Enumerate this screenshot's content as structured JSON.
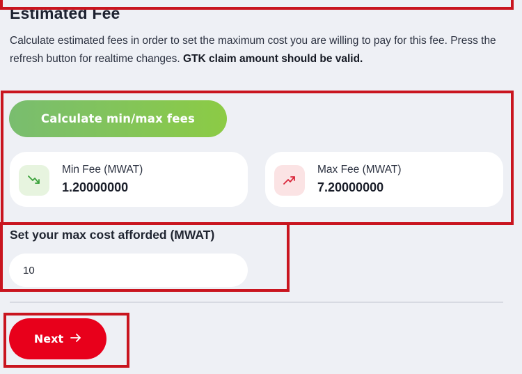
{
  "section": {
    "title": "Estimated Fee",
    "description_main": "Calculate estimated fees in order to set the maximum cost you are willing to pay for this fee. Press the refresh button for realtime changes.",
    "description_bold": "GTK claim amount should be valid."
  },
  "calculate_button": {
    "label": "Calculate min/max fees"
  },
  "fees": {
    "min": {
      "label": "Min Fee (MWAT)",
      "value": "1.20000000",
      "icon": "trending-down-icon",
      "color": "#3aa13a"
    },
    "max": {
      "label": "Max Fee (MWAT)",
      "value": "7.20000000",
      "icon": "trending-up-icon",
      "color": "#d9263a"
    }
  },
  "max_cost": {
    "label": "Set your max cost afforded (MWAT)",
    "value": "10"
  },
  "next_button": {
    "label": "Next",
    "icon": "arrow-right-icon"
  },
  "colors": {
    "accent_green": "#86c65a",
    "accent_red": "#e8001b",
    "highlight": "#c9151f",
    "background": "#eef0f5"
  }
}
